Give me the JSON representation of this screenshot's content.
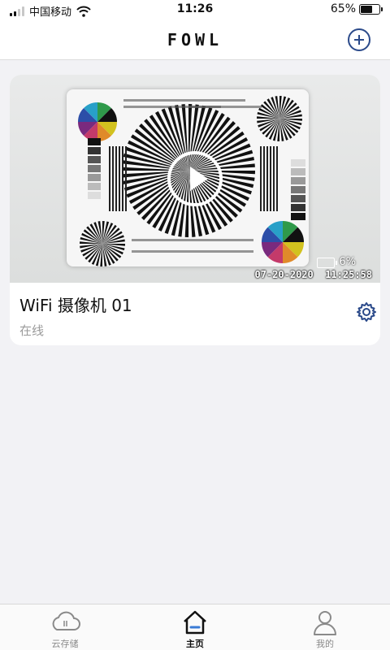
{
  "status_bar": {
    "carrier": "中国移动",
    "time": "11:26",
    "battery_text": "65%",
    "battery_level": 0.65
  },
  "header": {
    "logo": "FOWL",
    "add_icon": "plus-circle-icon"
  },
  "device": {
    "name": "WiFi 摄像机 01",
    "status": "在线",
    "preview": {
      "battery_text": "6%",
      "timestamp": "07-20-2020  11:25:58",
      "play_icon": "play-icon"
    },
    "settings_icon": "gear-icon"
  },
  "tabs": [
    {
      "label": "云存储",
      "icon": "cloud-icon",
      "active": false
    },
    {
      "label": "主页",
      "icon": "home-icon",
      "active": true
    },
    {
      "label": "我的",
      "icon": "user-icon",
      "active": false
    }
  ],
  "colors": {
    "accent": "#2b4a8a",
    "home_indicator": "#3a7bd5"
  }
}
